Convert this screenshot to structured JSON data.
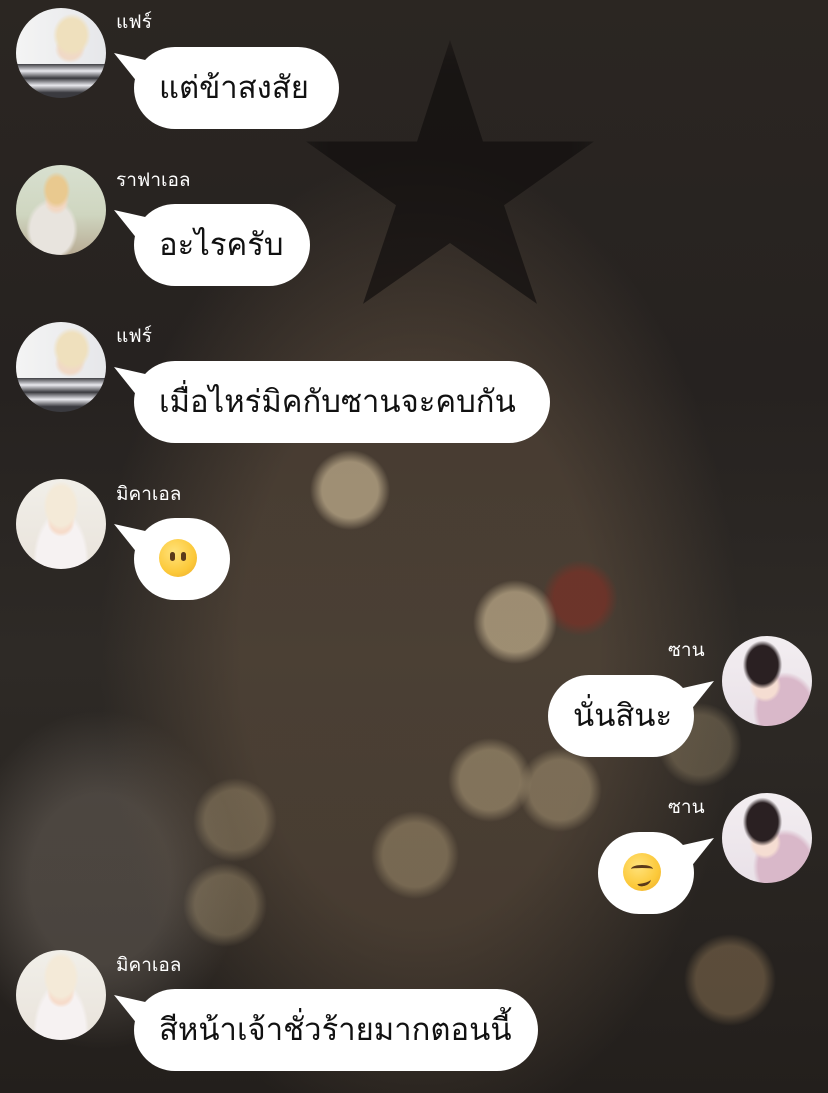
{
  "messages": [
    {
      "sender": "แฟร์",
      "avatar": "avatar-fair",
      "text": "แต่ข้าสงสัย",
      "side": "left"
    },
    {
      "sender": "ราฟาเอล",
      "avatar": "avatar-raphael",
      "text": "อะไรครับ",
      "side": "left"
    },
    {
      "sender": "แฟร์",
      "avatar": "avatar-fair",
      "text": "เมื่อไหร่มิคกับซานจะคบกัน",
      "side": "left"
    },
    {
      "sender": "มิคาเอล",
      "avatar": "avatar-michael",
      "emoji": "face-without-mouth-emoji",
      "side": "left"
    },
    {
      "sender": "ซาน",
      "avatar": "avatar-san",
      "text": "นั่นสินะ",
      "side": "right"
    },
    {
      "sender": "ซาน",
      "avatar": "avatar-san",
      "emoji": "smirking-face-emoji",
      "side": "right"
    },
    {
      "sender": "มิคาเอล",
      "avatar": "avatar-michael",
      "text": "สีหน้าเจ้าชั่วร้ายมากตอนนี้",
      "side": "left"
    }
  ],
  "colors": {
    "bubble": "#ffffff",
    "name_text": "#ffffff",
    "message_text": "#111111"
  }
}
